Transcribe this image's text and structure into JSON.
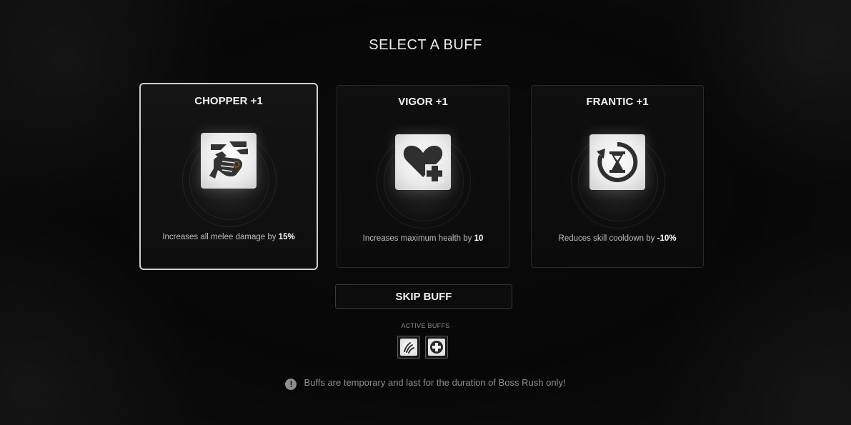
{
  "title": "SELECT A BUFF",
  "cards": [
    {
      "name": "CHOPPER +1",
      "icon": "fist-icon",
      "desc_prefix": "Increases all melee damage by ",
      "desc_value": "15%",
      "selected": true
    },
    {
      "name": "VIGOR +1",
      "icon": "heart-plus-icon",
      "desc_prefix": "Increases maximum health by ",
      "desc_value": "10",
      "selected": false
    },
    {
      "name": "FRANTIC +1",
      "icon": "hourglass-cycle-icon",
      "desc_prefix": "Reduces skill cooldown by ",
      "desc_value": "-10%",
      "selected": false
    }
  ],
  "skip_label": "SKIP BUFF",
  "active_buffs": {
    "label": "ACTIVE BUFFS",
    "icons": [
      "claw-icon",
      "health-cross-icon"
    ]
  },
  "notice": {
    "icon": "!",
    "text": "Buffs are temporary and last for the duration of Boss Rush only!"
  },
  "colors": {
    "background": "#070707",
    "selected_border": "#cfcfcf",
    "text": "#efefef"
  }
}
